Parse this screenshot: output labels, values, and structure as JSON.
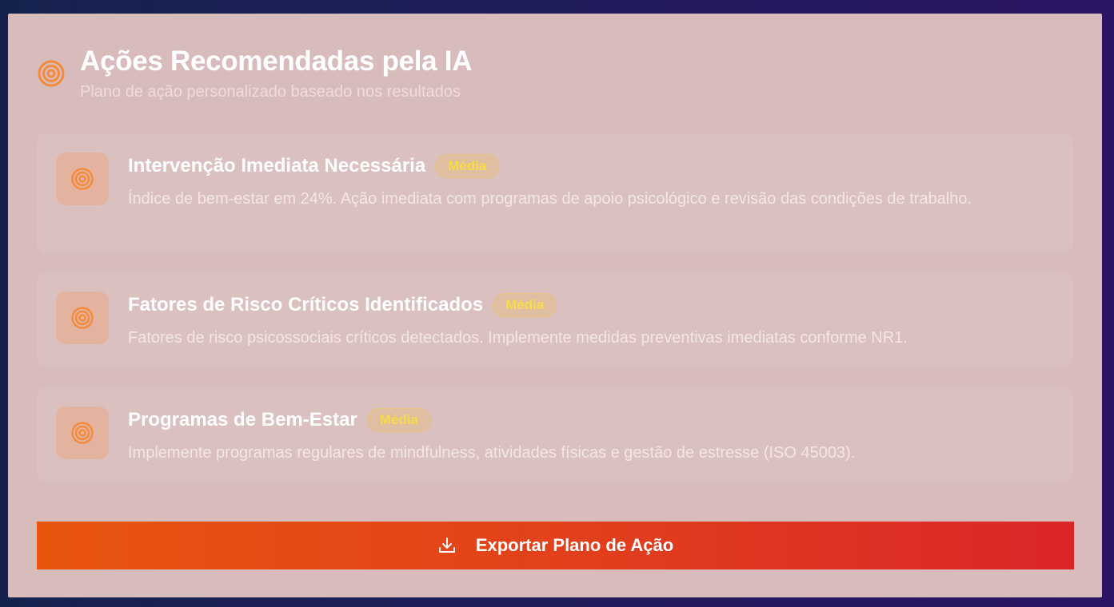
{
  "header": {
    "icon": "target-icon",
    "title": "Ações Recomendadas pela IA",
    "subtitle": "Plano de ação personalizado baseado nos resultados"
  },
  "recommendations": [
    {
      "icon": "target-icon",
      "title": "Intervenção Imediata Necessária",
      "badge": "Média",
      "description": "Índice de bem-estar em 24%. Ação imediata com programas de apoio psicológico e revisão das condições de trabalho."
    },
    {
      "icon": "target-icon",
      "title": "Fatores de Risco Críticos Identificados",
      "badge": "Média",
      "description": "Fatores de risco psicossociais críticos detectados. Implemente medidas preventivas imediatas conforme NR1."
    },
    {
      "icon": "target-icon",
      "title": "Programas de Bem-Estar",
      "badge": "Média",
      "description": "Implemente programas regulares de mindfulness, atividades físicas e gestão de estresse (ISO 45003)."
    }
  ],
  "export_button": {
    "icon": "download-icon",
    "label": "Exportar Plano de Ação"
  },
  "colors": {
    "accent_orange": "#f58a3a",
    "badge_text": "#f7dc47",
    "button_start": "#e8560e",
    "button_end": "#dc2529"
  }
}
